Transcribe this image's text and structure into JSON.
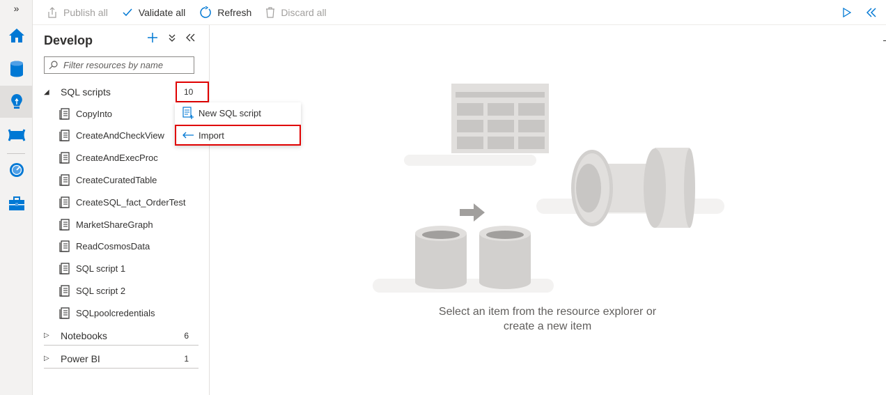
{
  "toolbar": {
    "publish_all": "Publish all",
    "validate_all": "Validate all",
    "refresh": "Refresh",
    "discard_all": "Discard all"
  },
  "panel": {
    "title": "Develop",
    "filter_placeholder": "Filter resources by name"
  },
  "groups": {
    "sql_scripts": {
      "label": "SQL scripts",
      "count": "10"
    },
    "notebooks": {
      "label": "Notebooks",
      "count": "6"
    },
    "power_bi": {
      "label": "Power BI",
      "count": "1"
    }
  },
  "scripts": [
    "CopyInto",
    "CreateAndCheckView",
    "CreateAndExecProc",
    "CreateCuratedTable",
    "CreateSQL_fact_OrderTest",
    "MarketShareGraph",
    "ReadCosmosData",
    "SQL script 1",
    "SQL script 2",
    "SQLpoolcredentials"
  ],
  "context_menu": {
    "new_sql_script": "New SQL script",
    "import": "Import"
  },
  "main": {
    "empty_line1": "Select an item from the resource explorer or",
    "empty_line2": "create a new item"
  },
  "colors": {
    "accent": "#0078d4",
    "highlight_border": "#e00000"
  }
}
